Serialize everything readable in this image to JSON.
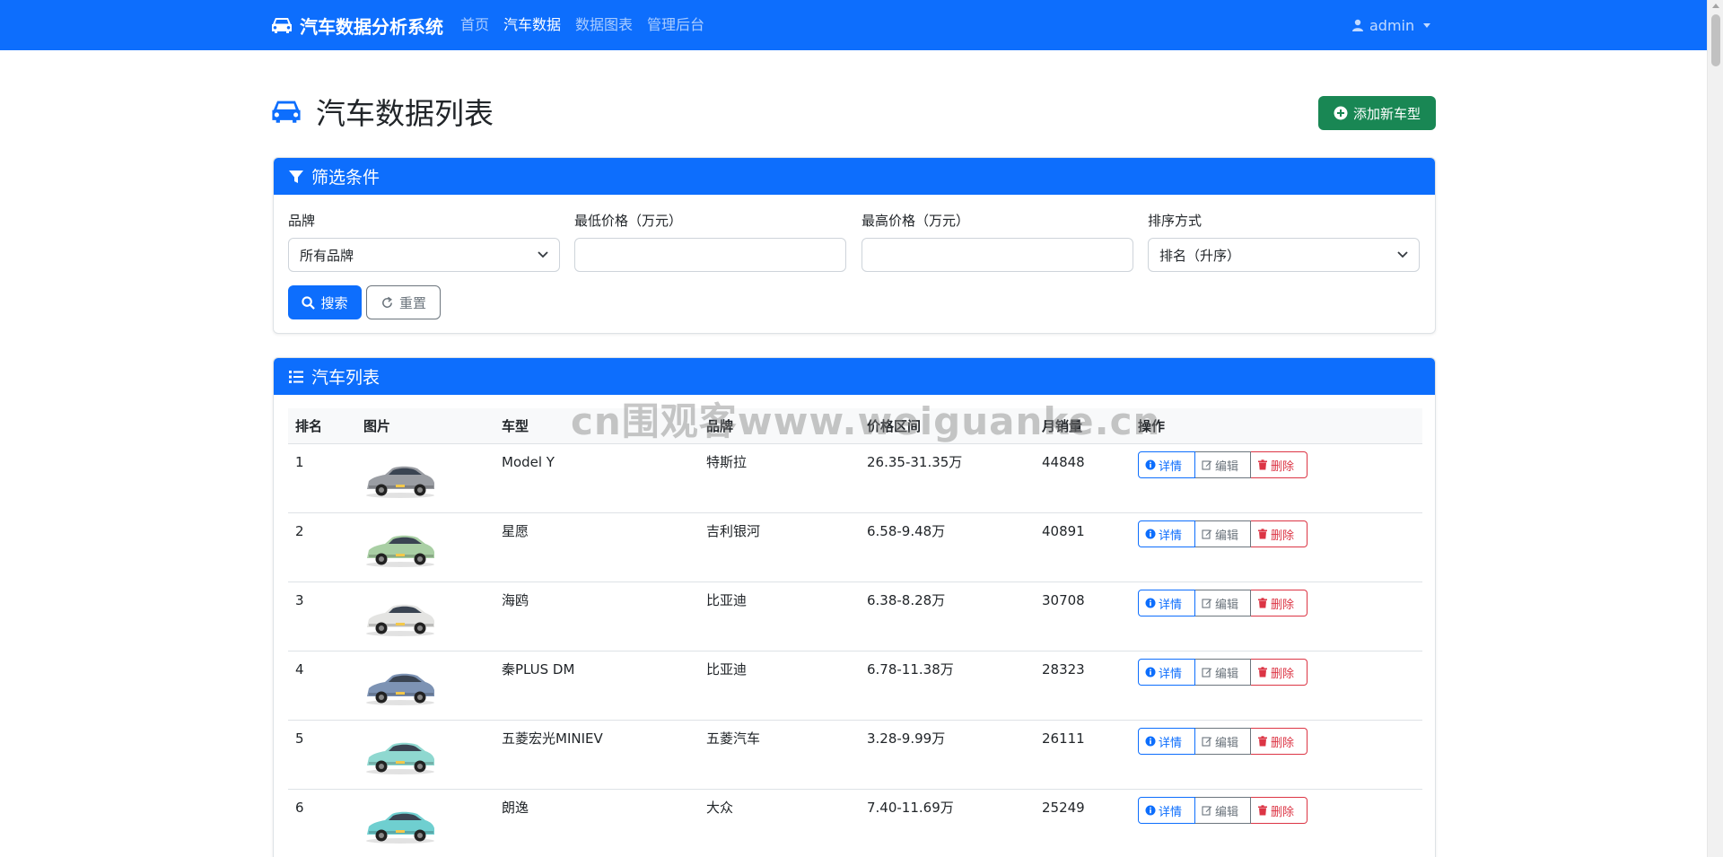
{
  "navbar": {
    "brand": "汽车数据分析系统",
    "links": [
      "首页",
      "汽车数据",
      "数据图表",
      "管理后台"
    ],
    "user": "admin"
  },
  "page": {
    "title": "汽车数据列表",
    "add_button": "添加新车型"
  },
  "filter": {
    "header": "筛选条件",
    "brand_label": "品牌",
    "brand_value": "所有品牌",
    "min_price_label": "最低价格（万元）",
    "min_price_value": "",
    "max_price_label": "最高价格（万元）",
    "max_price_value": "",
    "sort_label": "排序方式",
    "sort_value": "排名（升序）",
    "search_button": "搜索",
    "reset_button": "重置"
  },
  "list": {
    "header": "汽车列表",
    "columns": [
      "排名",
      "图片",
      "车型",
      "品牌",
      "价格区间",
      "月销量",
      "操作"
    ],
    "actions": {
      "detail": "详情",
      "edit": "编辑",
      "delete": "删除"
    },
    "rows": [
      {
        "rank": "1",
        "model": "Model Y",
        "brand": "特斯拉",
        "price": "26.35-31.35万",
        "sales": "44848",
        "car_color": "#9a9da3"
      },
      {
        "rank": "2",
        "model": "星愿",
        "brand": "吉利银河",
        "price": "6.58-9.48万",
        "sales": "40891",
        "car_color": "#a9cfa4"
      },
      {
        "rank": "3",
        "model": "海鸥",
        "brand": "比亚迪",
        "price": "6.38-8.28万",
        "sales": "30708",
        "car_color": "#e4e4e2"
      },
      {
        "rank": "4",
        "model": "秦PLUS DM",
        "brand": "比亚迪",
        "price": "6.78-11.38万",
        "sales": "28323",
        "car_color": "#7d93b4"
      },
      {
        "rank": "5",
        "model": "五菱宏光MINIEV",
        "brand": "五菱汽车",
        "price": "3.28-9.99万",
        "sales": "26111",
        "car_color": "#8fd8d0"
      },
      {
        "rank": "6",
        "model": "朗逸",
        "brand": "大众",
        "price": "7.40-11.69万",
        "sales": "25249",
        "car_color": "#6fcfd0"
      }
    ]
  },
  "watermark": "cn围观客www.weiguanke.cn",
  "colors": {
    "primary": "#0d6efd",
    "success": "#198754",
    "danger": "#dc3545",
    "secondary": "#6c757d"
  }
}
